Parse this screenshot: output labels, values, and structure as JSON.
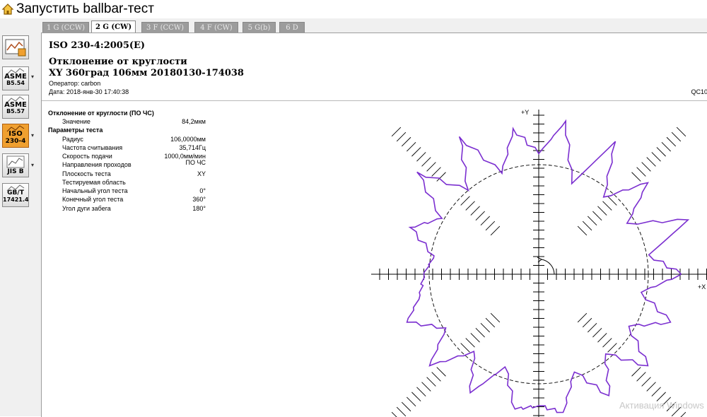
{
  "window": {
    "title": "Запустить ballbar-тест"
  },
  "sidebar": {
    "standards": [
      {
        "label": "",
        "icon": "run-test-icon",
        "active": false
      },
      {
        "label": "ASME B5.54",
        "icon": "asme-b554-icon",
        "active": false,
        "line1": "ASME",
        "line2": "B5.54"
      },
      {
        "label": "ASME B5.57",
        "icon": "asme-b557-icon",
        "active": false,
        "line1": "ASME",
        "line2": "B5.57"
      },
      {
        "label": "ISO 230-4",
        "icon": "iso-230-4-icon",
        "active": true,
        "line1": "ISO",
        "line2": "230-4"
      },
      {
        "label": "JIS B",
        "icon": "jis-b-icon",
        "active": false,
        "line1": "",
        "line2": "JIS B"
      },
      {
        "label": "GB/T 17421.4",
        "icon": "gbt-17421-icon",
        "active": false,
        "line1": "GB/T",
        "line2": "17421.4"
      }
    ]
  },
  "tabs": [
    {
      "label": "1 G (CCW)",
      "active": false
    },
    {
      "label": "2 G (CW)",
      "active": true
    },
    {
      "label": "3 F (CCW)",
      "active": false
    },
    {
      "label": "4 F (CW)",
      "active": false
    },
    {
      "label": "5 G(b)",
      "active": false
    },
    {
      "label": "6 D",
      "active": false
    }
  ],
  "report": {
    "standard": "ISO 230-4:2005(E)",
    "heading": "Отклонение от круглости",
    "subheading": "XY 360град 106мм 20180130-174038",
    "operator": "Оператор: carbon",
    "date": "Дата: 2018-янв-30 17:40:38",
    "qc": "QC10",
    "section_deviation": "Отклонение от круглости (ПО ЧС)",
    "value_label": "Значение",
    "value": "84,2мкм",
    "section_params": "Параметры теста",
    "params": [
      {
        "label": "Радиус",
        "value": "106,0000мм"
      },
      {
        "label": "Частота считывания",
        "value": "35,714Гц"
      },
      {
        "label": "Скорость подачи",
        "value": "1000,0мм/мин"
      },
      {
        "label": "Направления проходов",
        "value": "ПО ЧС"
      },
      {
        "label": "Плоскость теста",
        "value": "XY"
      },
      {
        "label": "Тестируемая область",
        "value": ""
      },
      {
        "label": "Начальный угол теста",
        "value": "0°"
      },
      {
        "label": "Конечный угол теста",
        "value": "360°"
      },
      {
        "label": "Угол дуги забега",
        "value": "180°"
      }
    ]
  },
  "chart_data": {
    "type": "polar",
    "axis_x_label": "+X",
    "axis_y_label": "+Y",
    "trace_color": "#7b2fd0",
    "reference_circle": "dashed",
    "direction_marker": "counter-clockwise arrow at center",
    "theta_deg": [
      0,
      10,
      20,
      30,
      40,
      50,
      60,
      70,
      80,
      90,
      100,
      110,
      120,
      130,
      140,
      150,
      160,
      170,
      180,
      190,
      200,
      210,
      220,
      230,
      240,
      250,
      260,
      270,
      280,
      290,
      300,
      310,
      320,
      330,
      340,
      350
    ],
    "radius_rel": [
      1.3,
      1.02,
      1.45,
      0.93,
      1.3,
      0.92,
      1.4,
      0.88,
      1.42,
      1.1,
      1.35,
      0.98,
      1.45,
      1.0,
      1.45,
      1.02,
      1.25,
      0.97,
      1.05,
      1.1,
      1.28,
      0.98,
      1.3,
      0.92,
      1.25,
      0.9,
      1.25,
      1.2,
      1.28,
      0.95,
      1.28,
      0.95,
      1.3,
      0.95,
      1.28,
      0.95
    ]
  },
  "watermark": "Активация Windows"
}
